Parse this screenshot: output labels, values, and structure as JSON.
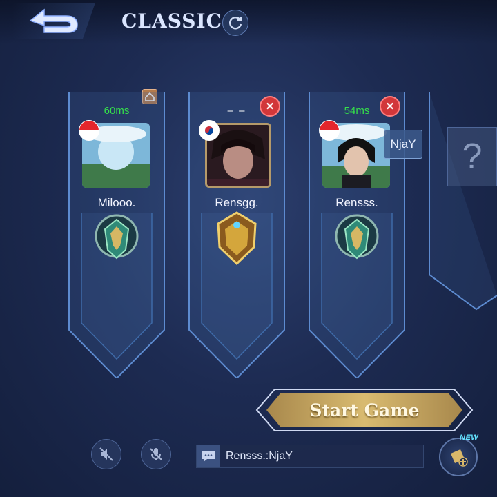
{
  "header": {
    "title": "CLASSIC"
  },
  "players": [
    {
      "ping": "60ms",
      "name": "Milooo.",
      "flag": "indonesia",
      "rank": "mythic"
    },
    {
      "ping": "– –",
      "name": "Rensgg.",
      "flag": "south-korea",
      "rank": "mythic-glory"
    },
    {
      "ping": "54ms",
      "name": "Rensss.",
      "flag": "indonesia",
      "rank": "mythic",
      "nick_tag": "NjaY"
    }
  ],
  "empty_slot": {
    "icon": "question-mark"
  },
  "actions": {
    "start_game": "Start Game"
  },
  "chat": {
    "last_message": "Rensss.:NjaY"
  },
  "new_feature": {
    "badge": "NEW"
  },
  "colors": {
    "ping_green": "#35e04a",
    "kick_red": "#d2373a",
    "start_gold": "#c9a75b",
    "background": "#1d2b52"
  }
}
